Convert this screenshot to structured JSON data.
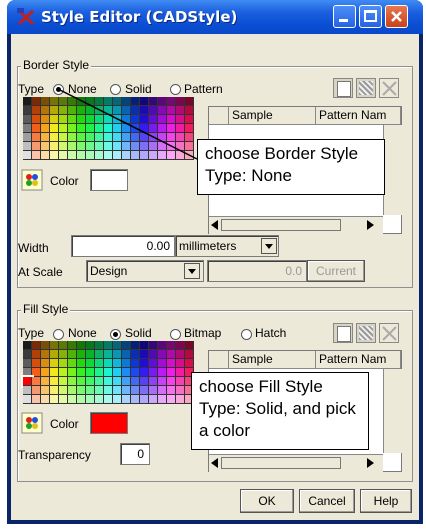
{
  "window": {
    "title": "Style Editor (CADStyle)",
    "title_icon": "x-tool-icon",
    "colors": {
      "title_bg": "#1c60e0",
      "client_bg": "#ece9d8",
      "fill_color": "#ff0000",
      "border_color": "#ffffff"
    }
  },
  "border_style": {
    "group_label": "Border Style",
    "type_label": "Type",
    "options": [
      "None",
      "Solid",
      "Pattern"
    ],
    "selected": "None",
    "color_label": "Color",
    "table_headers": [
      "Sample",
      "Pattern Nam"
    ],
    "width_label": "Width",
    "width_value": "0.00",
    "units_value": "millimeters",
    "at_scale_label": "At Scale",
    "at_scale_value": "Design",
    "scale_number": "0.0",
    "current_label": "Current"
  },
  "fill_style": {
    "group_label": "Fill Style",
    "type_label": "Type",
    "options": [
      "None",
      "Solid",
      "Bitmap",
      "Hatch"
    ],
    "selected": "Solid",
    "color_label": "Color",
    "table_headers": [
      "Sample",
      "Pattern Nam"
    ],
    "transparency_label": "Transparency",
    "transparency_value": "0"
  },
  "callouts": {
    "border": "choose Border Style Type: None",
    "fill": "choose Fill Style Type: Solid, and pick a color"
  },
  "buttons": {
    "ok": "OK",
    "cancel": "Cancel",
    "help": "Help"
  }
}
